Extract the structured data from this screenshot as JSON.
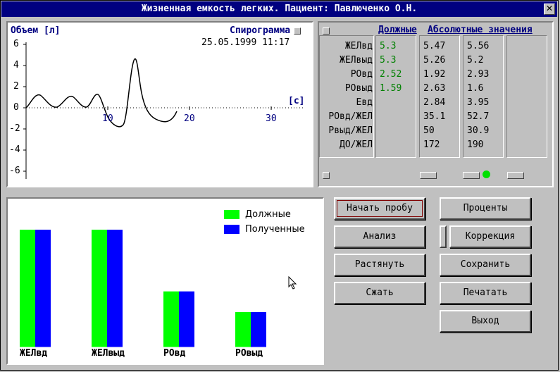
{
  "window": {
    "title": "Жизненная емкость легких. Пациент: Павлюченко О.Н."
  },
  "spirogram": {
    "ylabel": "Объем [л]",
    "xlabel": "[с]",
    "mode_label": "Спирограмма",
    "datetime": "25.05.1999 11:17",
    "y_ticks": [
      "6",
      "4",
      "2",
      "0",
      "-2",
      "-4",
      "-6"
    ],
    "x_ticks": [
      "10",
      "20",
      "30"
    ]
  },
  "table": {
    "header_due": "Должные",
    "header_abs": "Абсолютные значения",
    "rows": [
      {
        "label": "ЖЕЛвд",
        "due": "5.3",
        "v1": "5.47",
        "v2": "5.56"
      },
      {
        "label": "ЖЕЛвыд",
        "due": "5.3",
        "v1": "5.26",
        "v2": "5.2"
      },
      {
        "label": "РОвд",
        "due": "2.52",
        "v1": "1.92",
        "v2": "2.93"
      },
      {
        "label": "РОвыд",
        "due": "1.59",
        "v1": "2.63",
        "v2": "1.6"
      },
      {
        "label": "Евд",
        "due": "",
        "v1": "2.84",
        "v2": "3.95"
      },
      {
        "label": "РОвд/ЖЕЛ",
        "due": "",
        "v1": "35.1",
        "v2": "52.7"
      },
      {
        "label": "Рвыд/ЖЕЛ",
        "due": "",
        "v1": "50",
        "v2": "30.9"
      },
      {
        "label": "ДО/ЖЕЛ",
        "due": "",
        "v1": "172",
        "v2": "190"
      }
    ],
    "due_color": "#008000",
    "indicator_color": "#00e000"
  },
  "chart_data": {
    "type": "bar",
    "categories": [
      "ЖЕЛвд",
      "ЖЕЛвыд",
      "РОвд",
      "РОвыд"
    ],
    "series": [
      {
        "name": "Должные",
        "values": [
          5.3,
          5.3,
          2.52,
          1.59
        ],
        "color": "#00ff00"
      },
      {
        "name": "Полученные",
        "values": [
          5.3,
          5.3,
          2.52,
          1.59
        ],
        "color": "#0000ff"
      }
    ],
    "legend": "top-right"
  },
  "buttons": {
    "start": "Начать пробу",
    "percent": "Проценты",
    "analysis": "Анализ",
    "correction": "Коррекция",
    "stretch": "Растянуть",
    "save": "Сохранить",
    "compress": "Сжать",
    "print": "Печатать",
    "exit": "Выход"
  }
}
